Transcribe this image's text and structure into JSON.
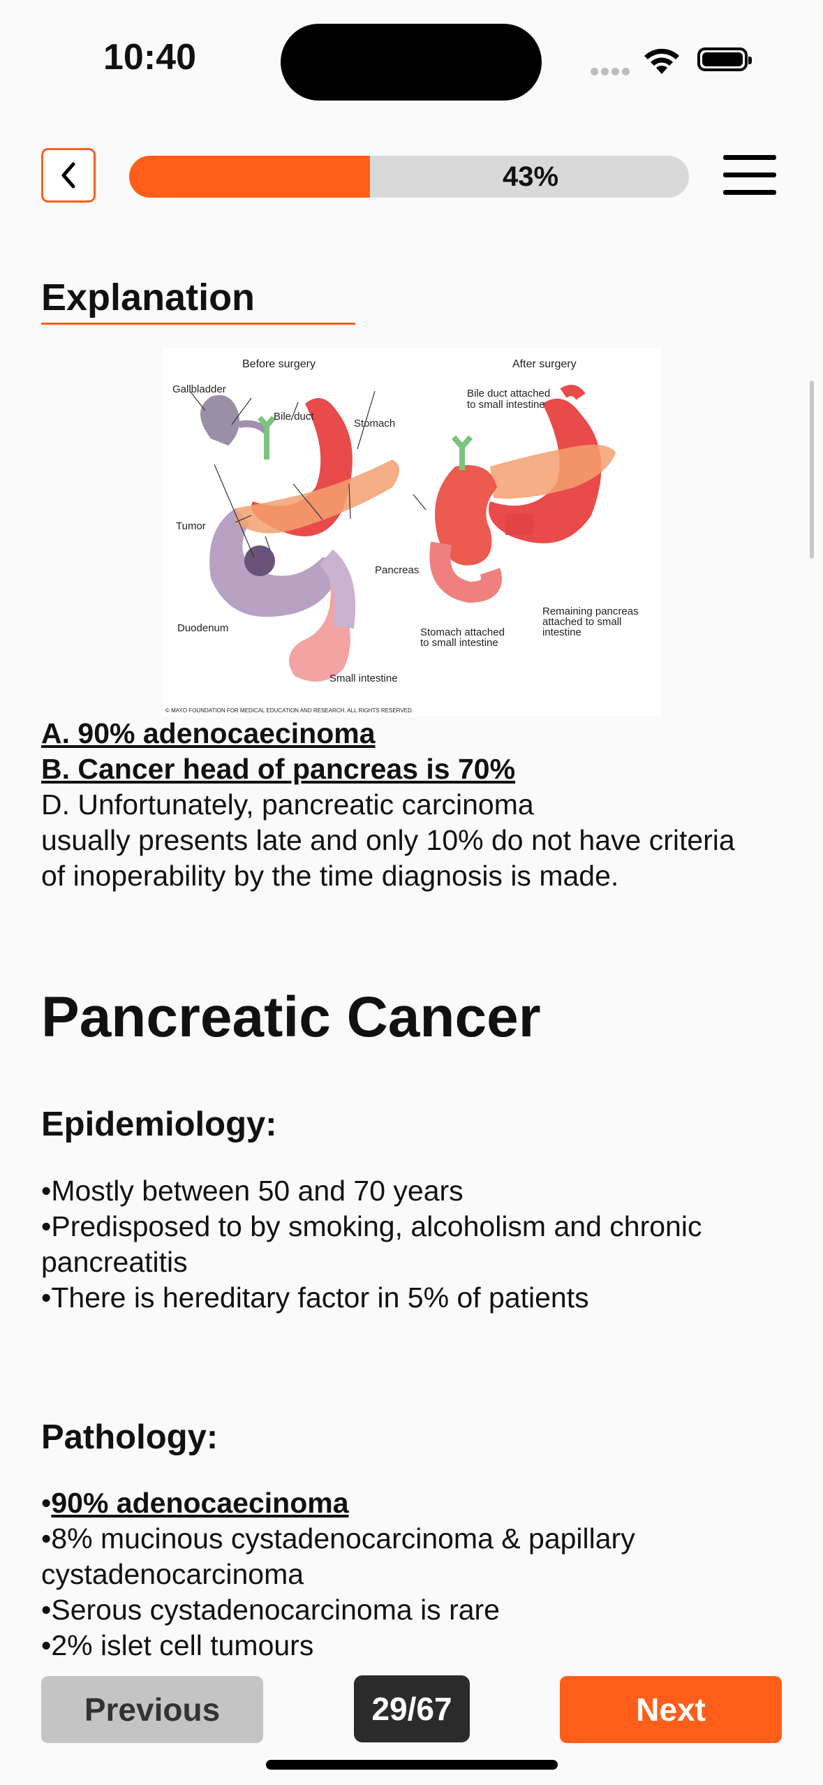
{
  "status_bar": {
    "time": "10:40"
  },
  "header": {
    "progress_percent": 43,
    "progress_label": "43%"
  },
  "explanation": {
    "title": "Explanation",
    "figure": {
      "before_label": "Before surgery",
      "after_label": "After surgery",
      "labels": {
        "gallbladder": "Gallbladder",
        "bile_duct": "Bile duct",
        "stomach": "Stomach",
        "tumor": "Tumor",
        "pancreas": "Pancreas",
        "duodenum": "Duodenum",
        "small_intestine": "Small intestine",
        "bile_duct_attached_1": "Bile duct attached",
        "bile_duct_attached_2": "to small intestine",
        "stomach_attached_1": "Stomach attached",
        "stomach_attached_2": "to small intestine",
        "remaining_1": "Remaining pancreas",
        "remaining_2": "attached to small",
        "remaining_3": "intestine"
      },
      "copyright": "© MAYO FOUNDATION FOR MEDICAL EDUCATION AND RESEARCH. ALL RIGHTS RESERVED."
    },
    "answer_a": "A. 90% adenocaecinoma",
    "answer_b": "B. Cancer head of pancreas is 70%",
    "answer_d_1": "D. Unfortunately, pancreatic carcinoma",
    "answer_d_2": "usually presents late and only 10% do not have criteria",
    "answer_d_3": "of inoperability by the time diagnosis is made."
  },
  "topic": {
    "title": "Pancreatic Cancer",
    "epidemiology": {
      "heading": "Epidemiology:",
      "line_1": "•Mostly between 50 and 70 years",
      "line_2": "•Predisposed to by smoking, alcoholism and chronic",
      "line_3": "pancreatitis",
      "line_4": "•There is hereditary factor in 5% of patients"
    },
    "pathology": {
      "heading": "Pathology:",
      "bullet_1_prefix": "•",
      "bullet_1_text": "90% adenocaecinoma",
      "line_2": "•8% mucinous cystadenocarcinoma & papillary",
      "line_3": "cystadenocarcinoma",
      "line_4": "•Serous cystadenocarcinoma is rare",
      "line_5": "•2% islet cell tumours"
    }
  },
  "footer": {
    "previous_label": "Previous",
    "counter": "29/67",
    "next_label": "Next"
  },
  "colors": {
    "accent": "#ff5e1a",
    "previous_bg": "#c4c4c4",
    "counter_bg": "#2b2b2b"
  }
}
